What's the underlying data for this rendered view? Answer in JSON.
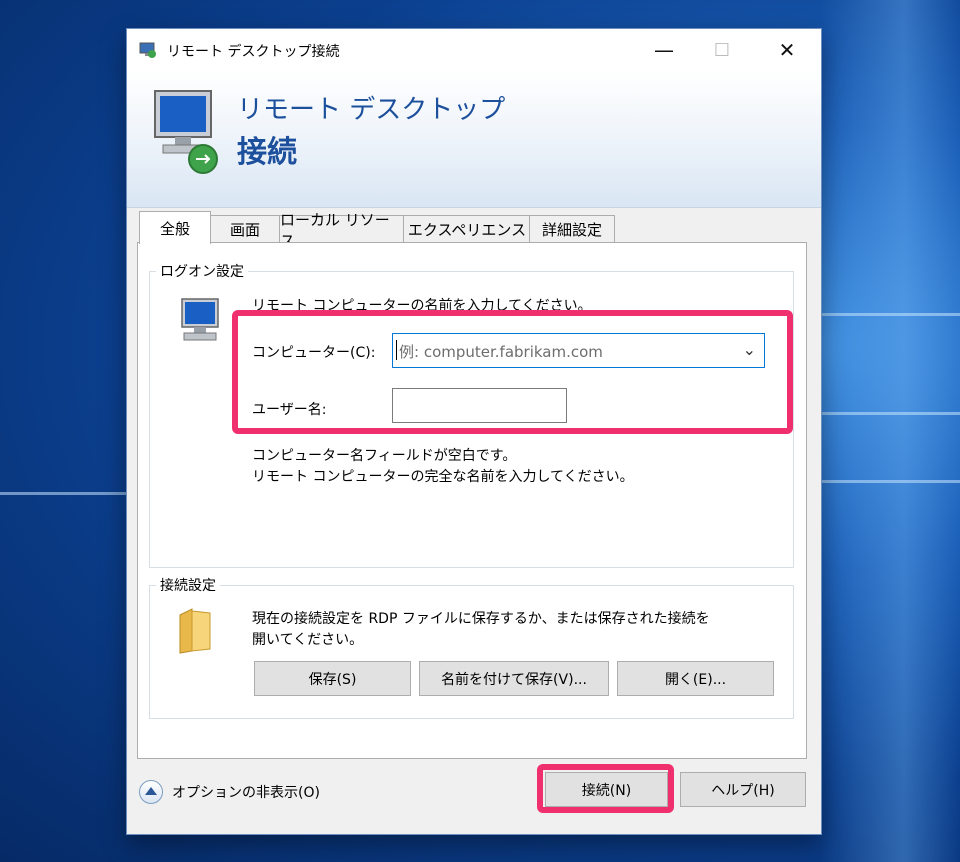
{
  "window": {
    "title": "リモート デスクトップ接続",
    "banner_line1": "リモート デスクトップ",
    "banner_line2": "接続"
  },
  "controls": {
    "minimize": "—",
    "maximize": "☐",
    "close": "✕"
  },
  "tabs": [
    {
      "label": "全般",
      "active": true
    },
    {
      "label": "画面"
    },
    {
      "label": "ローカル リソース"
    },
    {
      "label": "エクスペリエンス"
    },
    {
      "label": "詳細設定"
    }
  ],
  "logon": {
    "legend": "ログオン設定",
    "instruction": "リモート コンピューターの名前を入力してください。",
    "computer_label": "コンピューター(C):",
    "computer_placeholder": "例: computer.fabrikam.com",
    "username_label": "ユーザー名:",
    "username_value": "",
    "message_line1": "コンピューター名フィールドが空白です。",
    "message_line2": "リモート コンピューターの完全な名前を入力してください。"
  },
  "connection": {
    "legend": "接続設定",
    "description_line1": "現在の接続設定を RDP ファイルに保存するか、または保存された接続を",
    "description_line2": "開いてください。",
    "save": "保存(S)",
    "save_as": "名前を付けて保存(V)...",
    "open": "開く(E)..."
  },
  "footer": {
    "hide_options": "オプションの非表示(O)",
    "connect": "接続(N)",
    "help": "ヘルプ(H)"
  },
  "colors": {
    "highlight": "#f0306e",
    "brand_text": "#1c4f9c",
    "focus": "#0078d7"
  }
}
